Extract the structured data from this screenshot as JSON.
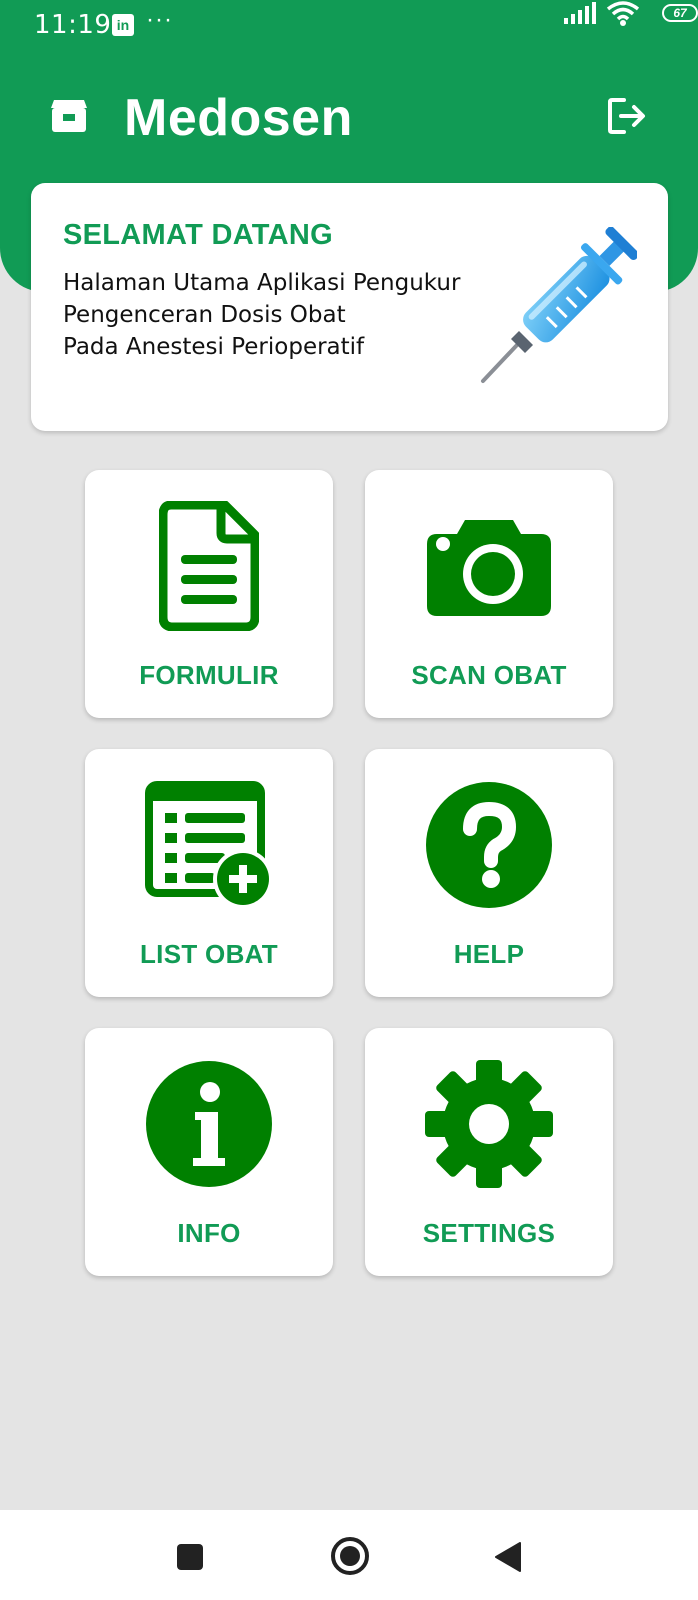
{
  "status": {
    "time": "11:19",
    "app_icon": "in",
    "more": "···",
    "battery": "67"
  },
  "appbar": {
    "title": "Medosen",
    "menu_icon": "store-icon",
    "logout_icon": "logout-icon"
  },
  "welcome": {
    "title": "SELAMAT DATANG",
    "lines": [
      "Halaman Utama Aplikasi Pengukur",
      "Pengenceran Dosis Obat",
      "Pada Anestesi Perioperatif"
    ],
    "image": "syringe"
  },
  "menu": [
    {
      "label": "FORMULIR",
      "icon": "document-icon"
    },
    {
      "label": "SCAN OBAT",
      "icon": "camera-icon"
    },
    {
      "label": "LIST OBAT",
      "icon": "list-add-icon"
    },
    {
      "label": "HELP",
      "icon": "help-icon"
    },
    {
      "label": "INFO",
      "icon": "info-icon"
    },
    {
      "label": "SETTINGS",
      "icon": "gear-icon"
    }
  ],
  "colors": {
    "primary": "#119b55",
    "icon_green": "#008000",
    "background": "#e4e4e4"
  },
  "navbar": {
    "recents": "recents-button",
    "home": "home-button",
    "back": "back-button"
  }
}
